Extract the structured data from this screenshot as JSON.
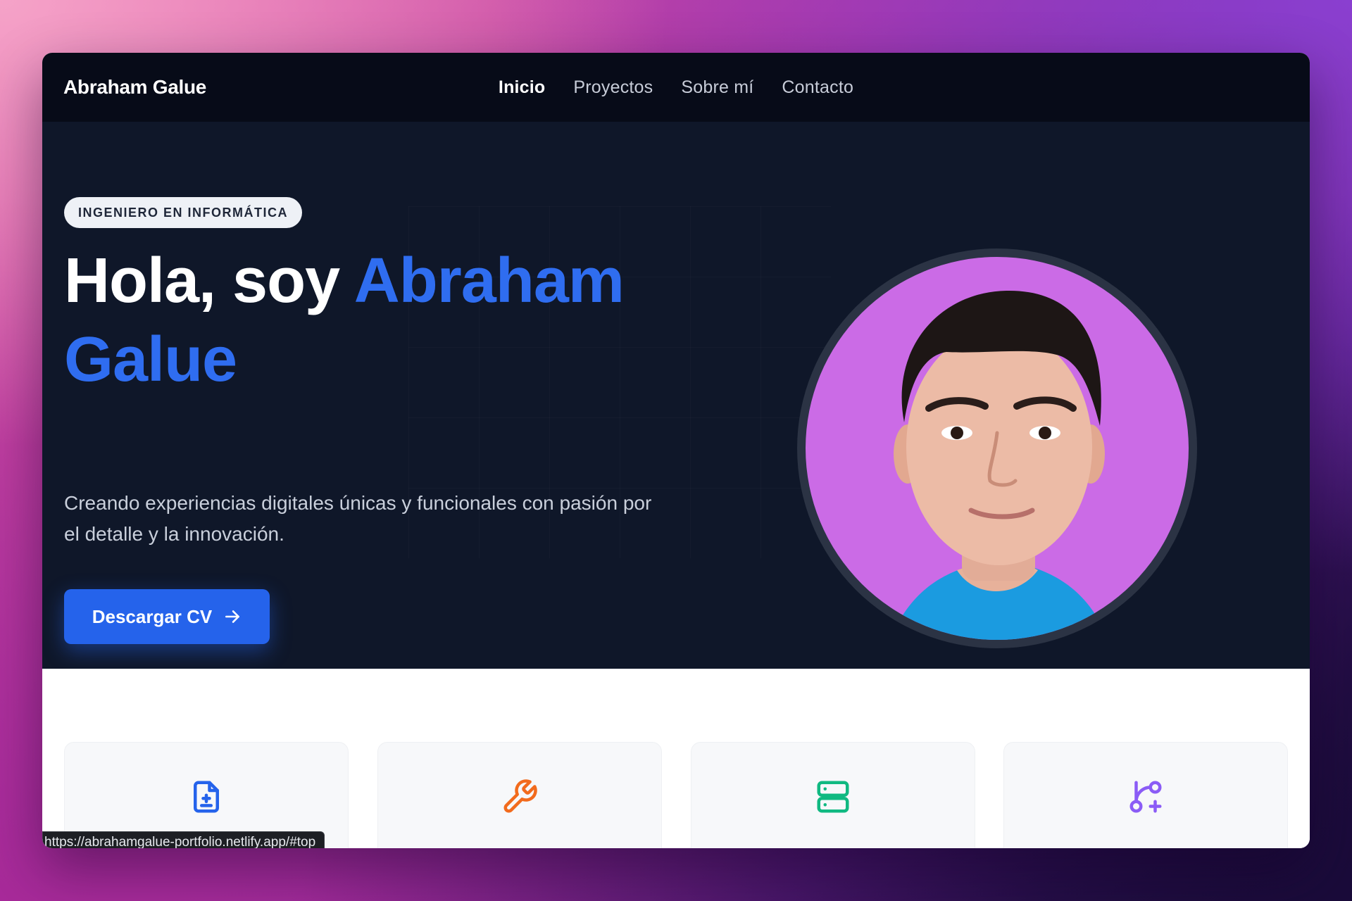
{
  "nav": {
    "brand": "Abraham Galue",
    "links": [
      "Inicio",
      "Proyectos",
      "Sobre mí",
      "Contacto"
    ],
    "active_index": 0
  },
  "hero": {
    "badge": "INGENIERO EN INFORMÁTICA",
    "title_prefix": "Hola, soy ",
    "title_highlight": "Abraham Galue",
    "subtitle": "Creando experiencias digitales únicas y funcionales con pasión por el detalle y la innovación.",
    "cta_label": "Descargar CV",
    "cta_icon": "arrow-right-icon"
  },
  "cards": [
    {
      "icon": "file-document-icon",
      "color": "#2563eb"
    },
    {
      "icon": "wrench-icon",
      "color": "#f26b1d"
    },
    {
      "icon": "server-icon",
      "color": "#10b981"
    },
    {
      "icon": "git-branch-plus-icon",
      "color": "#8b5cf6"
    }
  ],
  "status_bar": {
    "url": "https://abrahamgalue-portfolio.netlify.app/#top"
  },
  "colors": {
    "nav_bg": "#070b18",
    "hero_bg": "#0f1729",
    "accent": "#2f6df0",
    "button": "#2563eb",
    "avatar_bg": "#cb6be6"
  }
}
